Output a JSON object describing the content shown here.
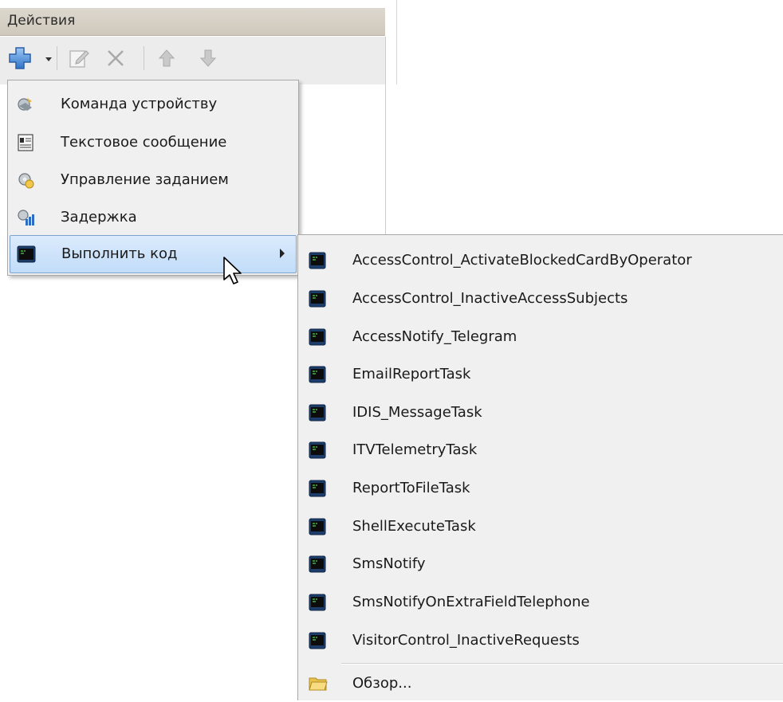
{
  "panel": {
    "header_title": "Действия"
  },
  "toolbar": {
    "icons": [
      "add-icon",
      "dropdown-arrow-icon",
      "edit-icon",
      "delete-icon",
      "move-up-icon",
      "move-down-icon"
    ]
  },
  "menu": {
    "items": [
      {
        "label": "Команда устройству",
        "icon": "device-command-icon"
      },
      {
        "label": "Текстовое сообщение",
        "icon": "text-message-icon"
      },
      {
        "label": "Управление заданием",
        "icon": "task-control-icon"
      },
      {
        "label": "Задержка",
        "icon": "delay-icon"
      },
      {
        "label": "Выполнить код",
        "icon": "console-icon",
        "highlighted": true,
        "has_submenu": true
      }
    ]
  },
  "submenu": {
    "items": [
      {
        "label": "AccessControl_ActivateBlockedCardByOperator",
        "icon": "console-icon"
      },
      {
        "label": "AccessControl_InactiveAccessSubjects",
        "icon": "console-icon"
      },
      {
        "label": "AccessNotify_Telegram",
        "icon": "console-icon"
      },
      {
        "label": "EmailReportTask",
        "icon": "console-icon"
      },
      {
        "label": "IDIS_MessageTask",
        "icon": "console-icon"
      },
      {
        "label": "ITVTelemetryTask",
        "icon": "console-icon"
      },
      {
        "label": "ReportToFileTask",
        "icon": "console-icon"
      },
      {
        "label": "ShellExecuteTask",
        "icon": "console-icon"
      },
      {
        "label": "SmsNotify",
        "icon": "console-icon"
      },
      {
        "label": "SmsNotifyOnExtraFieldTelephone",
        "icon": "console-icon"
      },
      {
        "label": "VisitorControl_InactiveRequests",
        "icon": "console-icon"
      }
    ],
    "browse": {
      "label": "Обзор...",
      "icon": "folder-icon"
    }
  },
  "colors": {
    "highlight_bg": "#c1dcf9",
    "highlight_border": "#7da2ce",
    "menu_bg": "#f0f0f0",
    "header_bg": "#d6d0c6"
  }
}
